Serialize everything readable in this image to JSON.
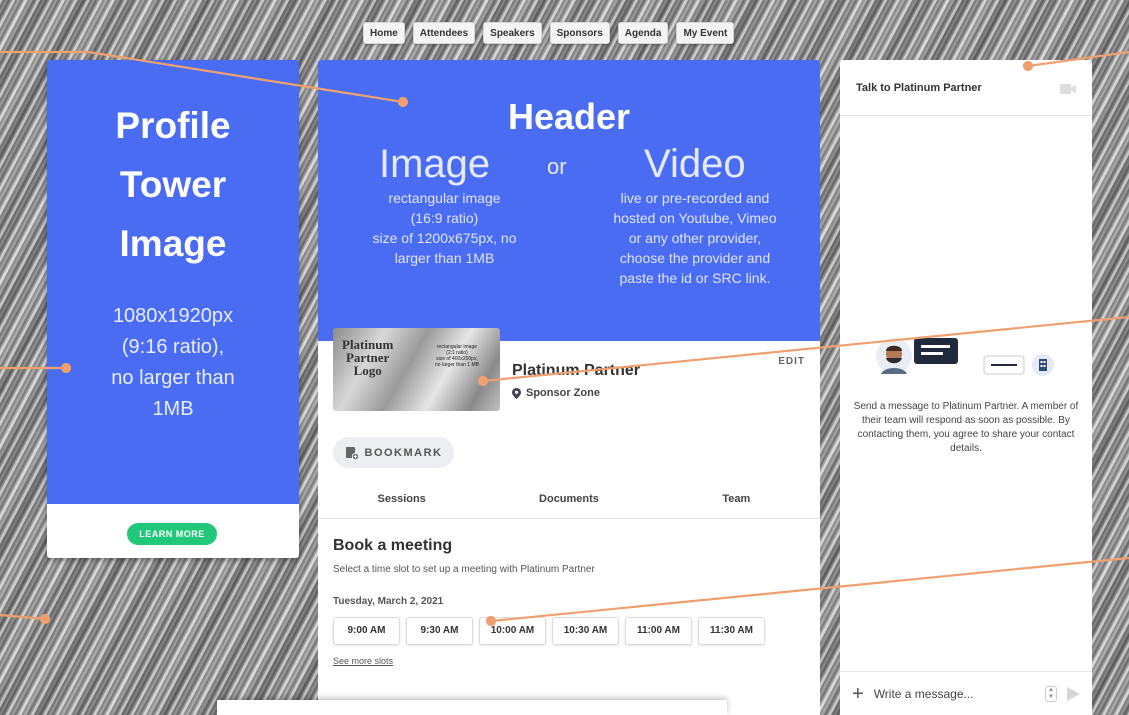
{
  "nav": [
    "Home",
    "Attendees",
    "Speakers",
    "Sponsors",
    "Agenda",
    "My Event"
  ],
  "tower": {
    "title": "Profile\nTower\nImage",
    "desc": "1080x1920px\n(9:16 ratio),\nno larger than\n1MB",
    "learn_more": "LEARN MORE"
  },
  "header": {
    "title": "Header",
    "image_word": "Image",
    "or_word": "or",
    "video_word": "Video",
    "image_desc": "rectangular image\n(16:9 ratio)\nsize of 1200x675px, no\nlarger than 1MB",
    "video_desc": "live or pre-recorded and\nhosted on Youtube, Vimeo\nor any other provider,\nchoose the provider and\npaste the id or SRC link."
  },
  "logo": {
    "big": "Platinum\nPartner\nLogo",
    "small": "rectangular image\n(2:1 ratio)\nsize of 400x200px,\nno larger than 1 MB"
  },
  "sponsor": {
    "name": "Platinum Partner",
    "zone": "Sponsor Zone",
    "edit": "EDIT"
  },
  "bookmark": "BOOKMARK",
  "tabs": [
    "Sessions",
    "Documents",
    "Team"
  ],
  "booking": {
    "title": "Book a meeting",
    "subtitle": "Select a time slot to set up a meeting with Platinum Partner",
    "date": "Tuesday, March 2, 2021",
    "slots": [
      "9:00 AM",
      "9:30 AM",
      "10:00 AM",
      "10:30 AM",
      "11:00 AM",
      "11:30 AM"
    ],
    "more": "See more slots"
  },
  "chat": {
    "title": "Talk to Platinum Partner",
    "message": "Send a message to Platinum Partner. A member of their team will respond as soon as possible. By contacting them, you agree to share your contact details.",
    "placeholder": "Write a message..."
  },
  "colors": {
    "accent_blue": "#4a6cf3",
    "learn_green": "#22c87a",
    "annotation": "#f0a06e"
  }
}
